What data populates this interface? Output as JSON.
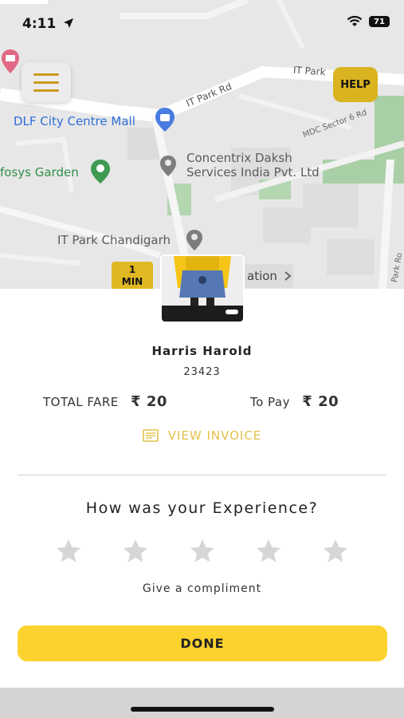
{
  "status_bar": {
    "time": "4:11",
    "battery": "71"
  },
  "map": {
    "labels": {
      "it_park_rd_1": "IT Park Rd",
      "it_park_rd_2": "IT Park",
      "dlf": "DLF City Centre Mall",
      "concentrix": "Concentrix Daksh",
      "concentrix_2": "Services India Pvt. Ltd",
      "infosys": "fosys Garden",
      "it_park_chd": "IT Park Chandigarh",
      "mdc": "MDC Sector 6 Rd",
      "park_rd": "Park Ro"
    },
    "help_label": "HELP",
    "eta": {
      "value": "1",
      "unit": "MIN"
    },
    "destination_chip": "ation"
  },
  "driver": {
    "name": "Harris Harold",
    "id": "23423"
  },
  "fare": {
    "total_label": "TOTAL FARE",
    "total_value": "₹ 20",
    "to_pay_label": "To Pay",
    "to_pay_value": "₹ 20"
  },
  "invoice_label": "VIEW INVOICE",
  "rating": {
    "title": "How was your Experience?",
    "stars_count": 5,
    "compliment": "Give a compliment"
  },
  "done_label": "DONE",
  "colors": {
    "accent": "#fcd22f",
    "invoice": "#e3c14a",
    "star": "#d6d6d6"
  }
}
